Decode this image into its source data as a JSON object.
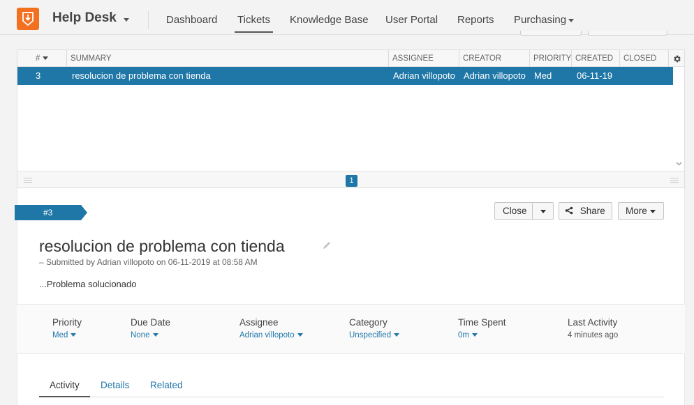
{
  "app": {
    "title": "Help Desk",
    "logo_icon": "inbox-download-icon",
    "brand_color": "#f37021",
    "accent_color": "#1f77a8"
  },
  "nav": {
    "items": [
      {
        "label": "Dashboard"
      },
      {
        "label": "Tickets"
      },
      {
        "label": "Knowledge Base"
      },
      {
        "label": "User Portal"
      },
      {
        "label": "Reports"
      },
      {
        "label": "Purchasing"
      }
    ],
    "active": "Tickets"
  },
  "table": {
    "columns": [
      "#",
      "SUMMARY",
      "ASSIGNEE",
      "CREATOR",
      "PRIORITY",
      "CREATED",
      "CLOSED"
    ],
    "rows": [
      {
        "id": "3",
        "summary": "resolucion de problema con tienda",
        "assignee": "Adrian villopoto",
        "creator": "Adrian villopoto",
        "priority": "Med",
        "created": "06-11-19",
        "closed": ""
      }
    ],
    "current_page": "1"
  },
  "ticket": {
    "number_label": "#3",
    "title": "resolucion de problema con tienda",
    "submitted": "– Submitted by Adrian villopoto on 06-11-2019 at 08:58 AM",
    "description": "...Problema solucionado",
    "buttons": {
      "close": "Close",
      "share": "Share",
      "more": "More"
    },
    "properties": [
      {
        "label": "Priority",
        "value": "Med"
      },
      {
        "label": "Due Date",
        "value": "None"
      },
      {
        "label": "Assignee",
        "value": "Adrian villopoto"
      },
      {
        "label": "Category",
        "value": "Unspecified"
      },
      {
        "label": "Time Spent",
        "value": "0m"
      },
      {
        "label": "Last Activity",
        "value": "4 minutes ago"
      }
    ],
    "tabs": [
      "Activity",
      "Details",
      "Related"
    ],
    "active_tab": "Activity"
  }
}
